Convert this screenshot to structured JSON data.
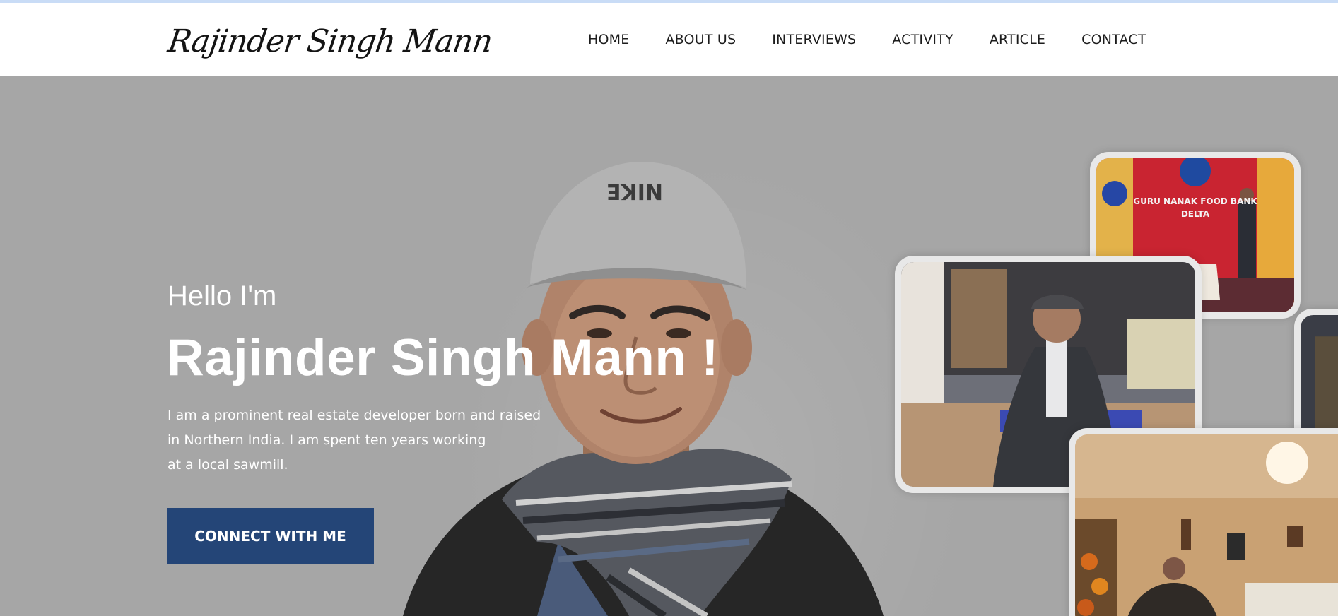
{
  "header": {
    "logo_text": "Rajinder Singh Mann",
    "nav": [
      "HOME",
      "ABOUT US",
      "INTERVIEWS",
      "ACTIVITY",
      "ARTICLE",
      "CONTACT"
    ]
  },
  "hero": {
    "greeting": "Hello I'm",
    "title": "Rajinder Singh Mann !",
    "description_lines": [
      "I am a prominent real estate developer born and raised",
      "in Northern India. I am spent ten years working",
      "at a local sawmill."
    ],
    "cta_label": "CONNECT WITH ME",
    "cap_text": "NIKE",
    "photos": {
      "food_bank_sign_line1": "GURU NANAK FOOD BANK",
      "food_bank_sign_line2": "DELTA"
    }
  },
  "colors": {
    "accent": "#244577",
    "hero_background": "#a6a6a6",
    "top_strip": "#c9dcf6"
  }
}
